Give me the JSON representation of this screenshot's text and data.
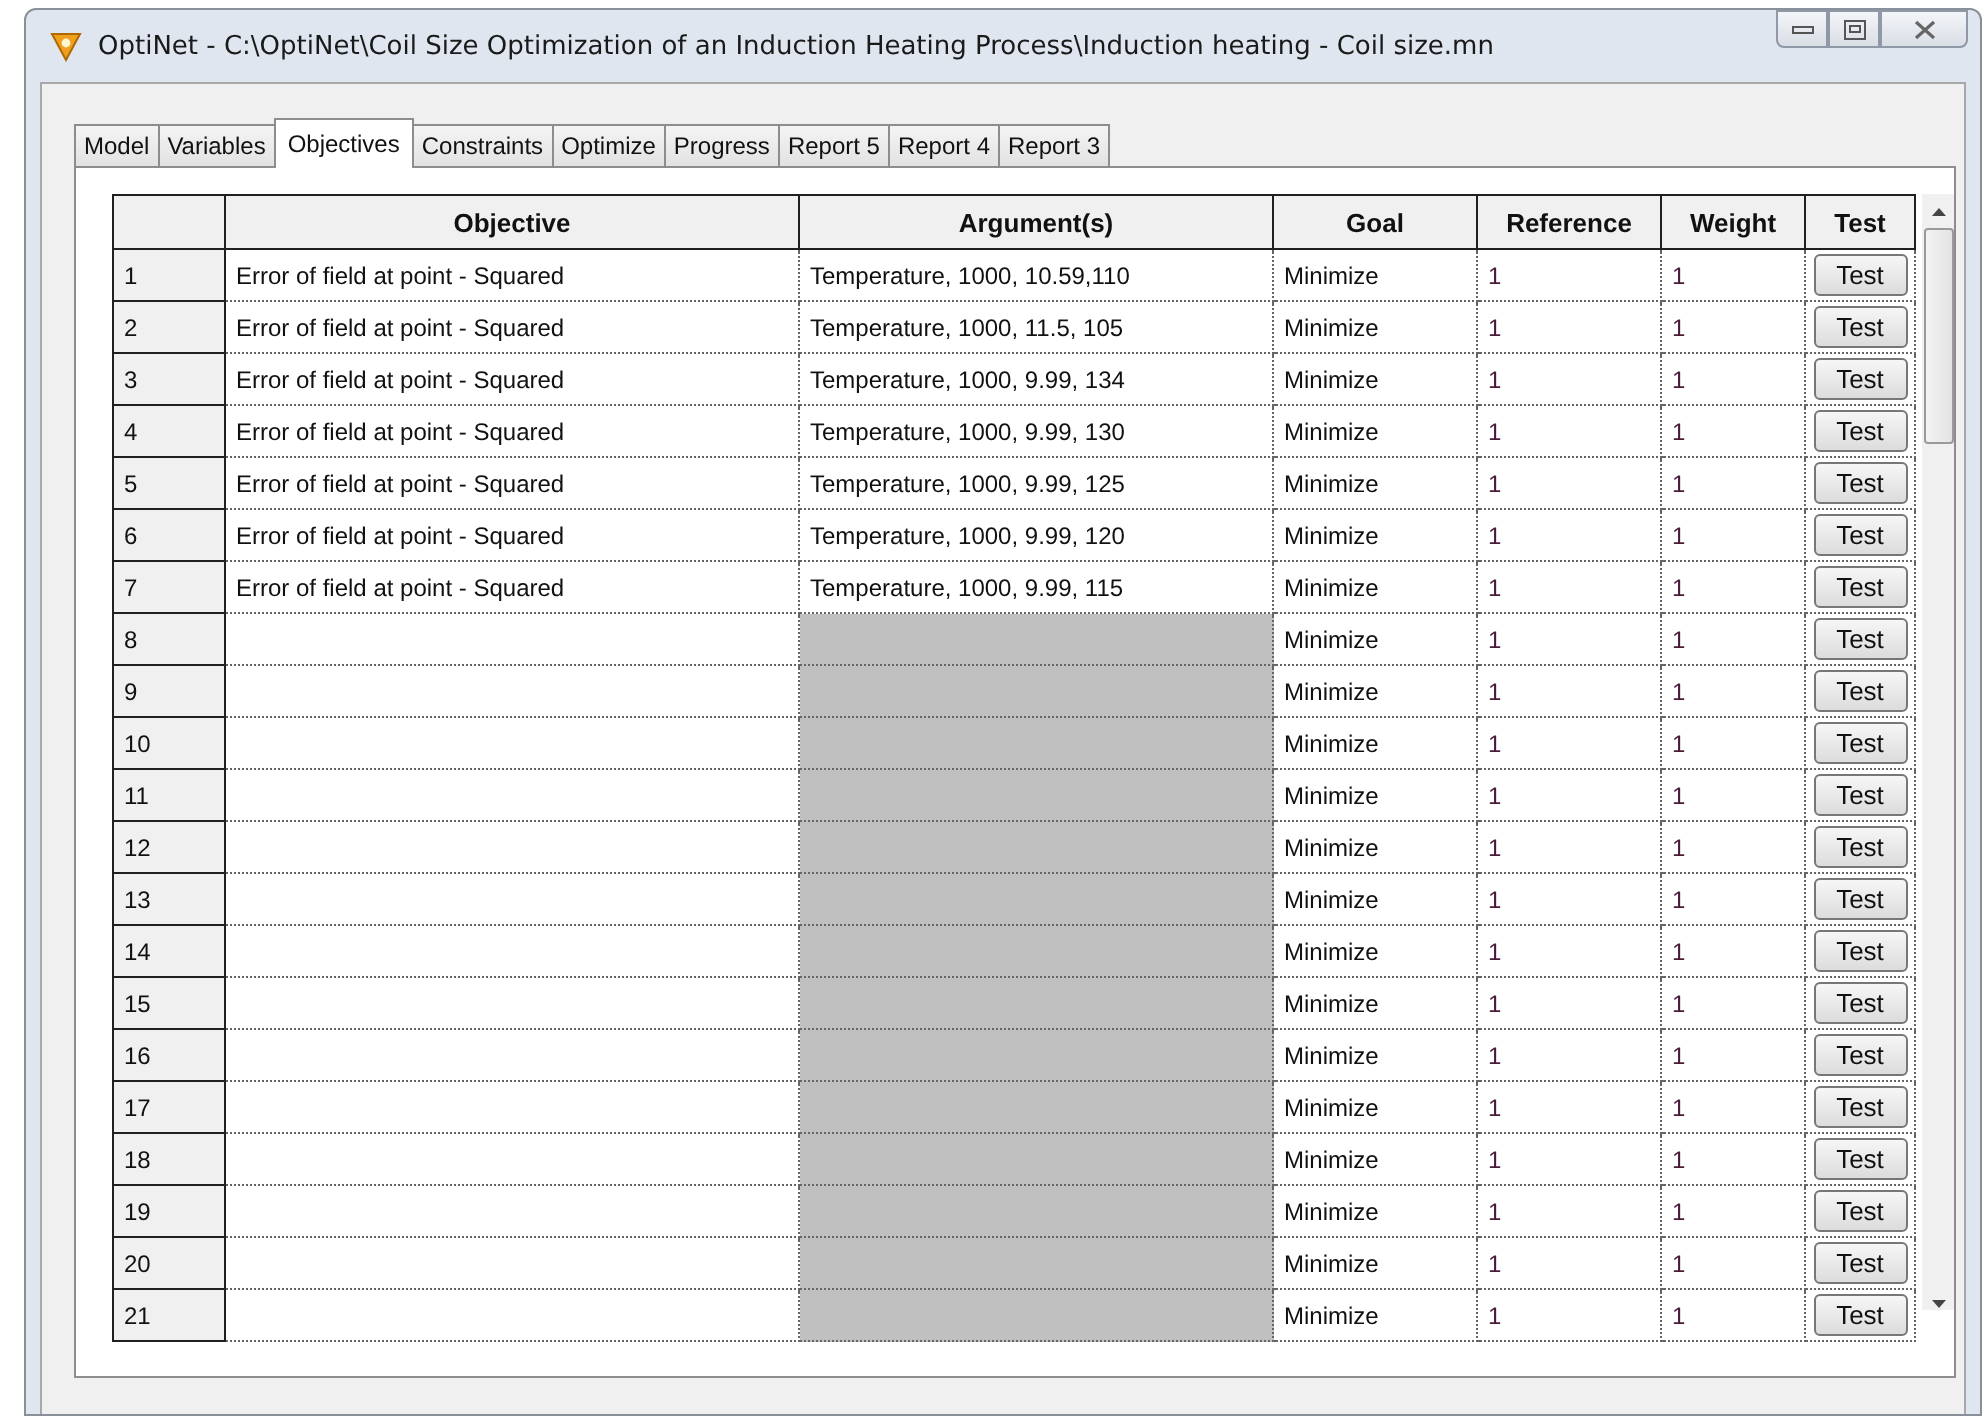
{
  "window": {
    "title": "OptiNet - C:\\OptiNet\\Coil Size Optimization of an Induction Heating Process\\Induction heating - Coil size.mn"
  },
  "tabs": [
    {
      "label": "Model",
      "selected": false
    },
    {
      "label": "Variables",
      "selected": false
    },
    {
      "label": "Objectives",
      "selected": true
    },
    {
      "label": "Constraints",
      "selected": false
    },
    {
      "label": "Optimize",
      "selected": false
    },
    {
      "label": "Progress",
      "selected": false
    },
    {
      "label": "Report 5",
      "selected": false
    },
    {
      "label": "Report 4",
      "selected": false
    },
    {
      "label": "Report 3",
      "selected": false
    }
  ],
  "table": {
    "columns": [
      "Objective",
      "Argument(s)",
      "Goal",
      "Reference",
      "Weight",
      "Test"
    ],
    "rows": [
      {
        "number": "1",
        "objective": "Error of field at point - Squared",
        "argument": "Temperature, 1000, 10.59,110",
        "argument_disabled": false,
        "goal": "Minimize",
        "reference": "1",
        "weight": "1",
        "button": "Test"
      },
      {
        "number": "2",
        "objective": "Error of field at point - Squared",
        "argument": "Temperature, 1000, 11.5, 105",
        "argument_disabled": false,
        "goal": "Minimize",
        "reference": "1",
        "weight": "1",
        "button": "Test"
      },
      {
        "number": "3",
        "objective": "Error of field at point - Squared",
        "argument": "Temperature, 1000, 9.99, 134",
        "argument_disabled": false,
        "goal": "Minimize",
        "reference": "1",
        "weight": "1",
        "button": "Test"
      },
      {
        "number": "4",
        "objective": "Error of field at point - Squared",
        "argument": "Temperature, 1000, 9.99, 130",
        "argument_disabled": false,
        "goal": "Minimize",
        "reference": "1",
        "weight": "1",
        "button": "Test"
      },
      {
        "number": "5",
        "objective": "Error of field at point - Squared",
        "argument": "Temperature, 1000, 9.99, 125",
        "argument_disabled": false,
        "goal": "Minimize",
        "reference": "1",
        "weight": "1",
        "button": "Test"
      },
      {
        "number": "6",
        "objective": "Error of field at point - Squared",
        "argument": "Temperature, 1000, 9.99, 120",
        "argument_disabled": false,
        "goal": "Minimize",
        "reference": "1",
        "weight": "1",
        "button": "Test"
      },
      {
        "number": "7",
        "objective": "Error of field at point - Squared",
        "argument": "Temperature, 1000, 9.99, 115",
        "argument_disabled": false,
        "goal": "Minimize",
        "reference": "1",
        "weight": "1",
        "button": "Test"
      },
      {
        "number": "8",
        "argument_disabled": true,
        "goal": "Minimize",
        "reference": "1",
        "weight": "1",
        "button": "Test"
      },
      {
        "number": "9",
        "argument_disabled": true,
        "goal": "Minimize",
        "reference": "1",
        "weight": "1",
        "button": "Test"
      },
      {
        "number": "10",
        "argument_disabled": true,
        "goal": "Minimize",
        "reference": "1",
        "weight": "1",
        "button": "Test"
      },
      {
        "number": "11",
        "argument_disabled": true,
        "goal": "Minimize",
        "reference": "1",
        "weight": "1",
        "button": "Test"
      },
      {
        "number": "12",
        "argument_disabled": true,
        "goal": "Minimize",
        "reference": "1",
        "weight": "1",
        "button": "Test"
      },
      {
        "number": "13",
        "argument_disabled": true,
        "goal": "Minimize",
        "reference": "1",
        "weight": "1",
        "button": "Test"
      },
      {
        "number": "14",
        "argument_disabled": true,
        "goal": "Minimize",
        "reference": "1",
        "weight": "1",
        "button": "Test"
      },
      {
        "number": "15",
        "argument_disabled": true,
        "goal": "Minimize",
        "reference": "1",
        "weight": "1",
        "button": "Test"
      },
      {
        "number": "16",
        "argument_disabled": true,
        "goal": "Minimize",
        "reference": "1",
        "weight": "1",
        "button": "Test"
      },
      {
        "number": "17",
        "argument_disabled": true,
        "goal": "Minimize",
        "reference": "1",
        "weight": "1",
        "button": "Test"
      },
      {
        "number": "18",
        "argument_disabled": true,
        "goal": "Minimize",
        "reference": "1",
        "weight": "1",
        "button": "Test"
      },
      {
        "number": "19",
        "argument_disabled": true,
        "goal": "Minimize",
        "reference": "1",
        "weight": "1",
        "button": "Test"
      },
      {
        "number": "20",
        "argument_disabled": true,
        "goal": "Minimize",
        "reference": "1",
        "weight": "1",
        "button": "Test"
      },
      {
        "number": "21",
        "argument_disabled": true,
        "goal": "Minimize",
        "reference": "1",
        "weight": "1",
        "button": "Test"
      }
    ]
  }
}
